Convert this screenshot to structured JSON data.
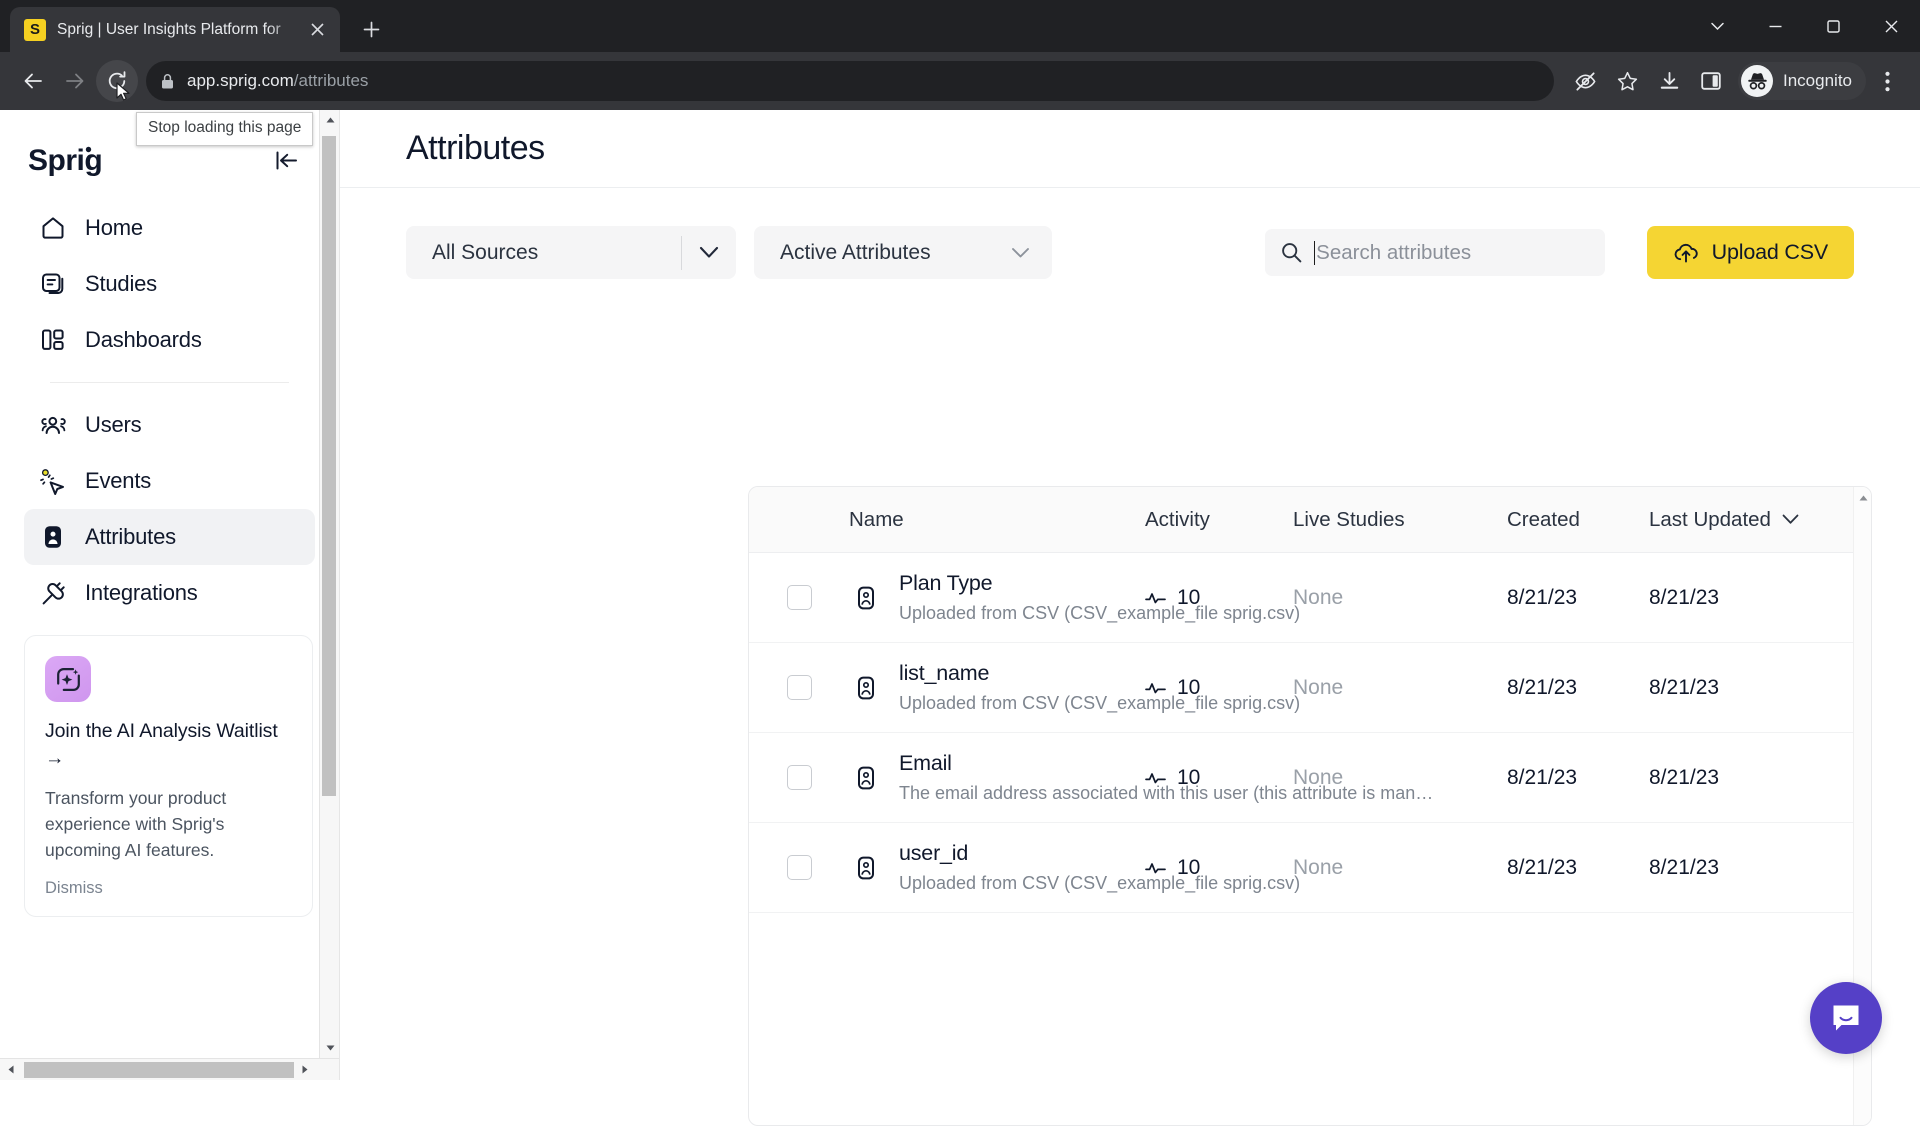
{
  "browser": {
    "tab": {
      "favicon_letter": "S",
      "title": "Sprig | User Insights Platform for",
      "close_label": "×"
    },
    "new_tab_label": "+",
    "window_controls": {
      "minimize": "minimize-icon",
      "maximize": "maximize-icon",
      "close": "close-icon",
      "tab_search": "tab-search-icon"
    },
    "omnibox": {
      "domain": "app.sprig.com",
      "path": "/attributes",
      "lock_icon": "lock-icon"
    },
    "toolbar_icons": [
      "eye-slash-icon",
      "star-icon",
      "download-icon",
      "side-panel-icon"
    ],
    "profile": {
      "label": "Incognito",
      "avatar": "incognito-avatar-icon"
    },
    "menu_icon": "three-dot-menu-icon",
    "tooltip": "Stop loading this page"
  },
  "sidebar": {
    "logo": "Sprig",
    "collapse_icon": "collapse-panel-icon",
    "items": [
      {
        "label": "Home",
        "icon": "home-icon",
        "active": false
      },
      {
        "label": "Studies",
        "icon": "studies-icon",
        "active": false
      },
      {
        "label": "Dashboards",
        "icon": "dashboards-icon",
        "active": false
      },
      {
        "label": "Users",
        "icon": "users-icon",
        "active": false
      },
      {
        "label": "Events",
        "icon": "events-cursor-icon",
        "active": false
      },
      {
        "label": "Attributes",
        "icon": "attributes-badge-icon",
        "active": true
      },
      {
        "label": "Integrations",
        "icon": "integrations-plug-icon",
        "active": false
      }
    ],
    "ai_card": {
      "icon": "ai-sparkle-icon",
      "title": "Join the AI Analysis Waitlist →",
      "body": "Transform your product experience with Sprig's upcoming AI features.",
      "dismiss": "Dismiss"
    }
  },
  "main": {
    "title": "Attributes",
    "filters": {
      "source": {
        "value": "All Sources",
        "chevron": "chevron-down-icon"
      },
      "status": {
        "value": "Active Attributes",
        "chevron": "chevron-down-icon"
      }
    },
    "search": {
      "placeholder": "Search attributes",
      "value": "",
      "icon": "search-icon"
    },
    "upload_button": {
      "label": "Upload CSV",
      "icon": "upload-cloud-icon"
    },
    "table": {
      "columns": [
        "Name",
        "Activity",
        "Live Studies",
        "Created",
        "Last Updated"
      ],
      "sort_column": "Last Updated",
      "sort_icon": "chevron-down-icon",
      "rows": [
        {
          "name": "Plan Type",
          "description": "Uploaded from CSV (CSV_example_file sprig.csv)",
          "activity": "10",
          "live_studies": "None",
          "created": "8/21/23",
          "last_updated": "8/21/23",
          "checked": false
        },
        {
          "name": "list_name",
          "description": "Uploaded from CSV (CSV_example_file sprig.csv)",
          "activity": "10",
          "live_studies": "None",
          "created": "8/21/23",
          "last_updated": "8/21/23",
          "checked": false
        },
        {
          "name": "Email",
          "description": "The email address associated with this user (this attribute is man…",
          "activity": "10",
          "live_studies": "None",
          "created": "8/21/23",
          "last_updated": "8/21/23",
          "checked": false
        },
        {
          "name": "user_id",
          "description": "Uploaded from CSV (CSV_example_file sprig.csv)",
          "activity": "10",
          "live_studies": "None",
          "created": "8/21/23",
          "last_updated": "8/21/23",
          "checked": false
        }
      ]
    }
  },
  "widgets": {
    "intercom": "intercom-chat-icon"
  },
  "colors": {
    "brand_yellow": "#f5d533",
    "chrome_dark": "#202124",
    "chrome_toolbar": "#35363a",
    "text_primary": "#10182b",
    "text_muted": "#7e858f",
    "intercom_purple": "#5540c7",
    "ai_card_purple": "#cf96ee"
  }
}
